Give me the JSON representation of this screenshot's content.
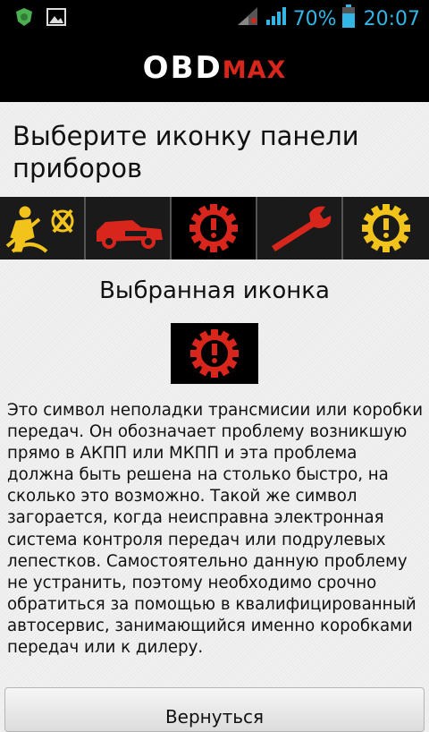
{
  "status_bar": {
    "battery_percent": "70%",
    "time": "20:07",
    "icons": [
      "app-notification-icon",
      "image-notification-icon",
      "signal-icon",
      "signal-icon",
      "battery-icon"
    ]
  },
  "app_bar": {
    "logo_part1": "OBD",
    "logo_part2": "MAX"
  },
  "page": {
    "title": "Выберите иконку панели приборов",
    "selected_label": "Выбранная иконка",
    "description": "Это символ неполадки трансмисии или коробки передач. Он обозначает проблему возникшую прямо в АКПП или МКПП и эта проблема должна быть решена на столько быстро, на сколько это возможно. Такой же символ загорается, когда неисправна электронная система контроля передач или подрулевых лепестков. Самостоятельно данную проблему не устранить, поэтому необходимо срочно обратиться за помощью в квалифицированный автосервис, занимающийся именно коробками передач или к дилеру.",
    "back_button": "Вернуться"
  },
  "icons": [
    {
      "name": "seatbelt-airbag-warning-icon",
      "color": "#f2c31a"
    },
    {
      "name": "car-trunk-open-icon",
      "color": "#d9261c"
    },
    {
      "name": "transmission-warning-icon",
      "color": "#d9261c",
      "selected": true
    },
    {
      "name": "wrench-service-icon",
      "color": "#d9261c"
    },
    {
      "name": "gear-warning-icon",
      "color": "#f2c31a"
    }
  ],
  "colors": {
    "accent_blue": "#33b5e5",
    "warning_red": "#d9261c",
    "warning_yellow": "#f2c31a"
  }
}
